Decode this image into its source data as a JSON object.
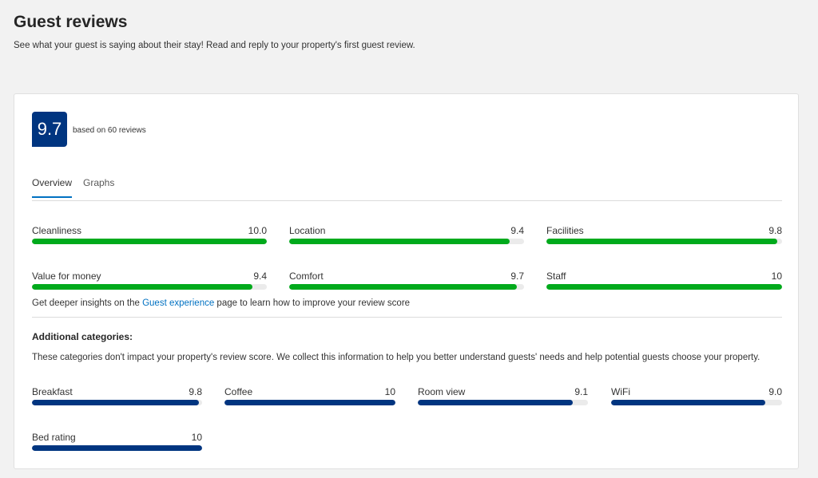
{
  "header": {
    "title": "Guest reviews",
    "subtitle": "See what your guest is saying about their stay! Read and reply to your property's first guest review."
  },
  "score": {
    "value": "9.7",
    "caption": "based on 60 reviews"
  },
  "tabs": [
    {
      "label": "Overview",
      "active": true
    },
    {
      "label": "Graphs",
      "active": false
    }
  ],
  "main_categories": [
    {
      "label": "Cleanliness",
      "value": "10.0",
      "score": 10.0
    },
    {
      "label": "Location",
      "value": "9.4",
      "score": 9.4
    },
    {
      "label": "Facilities",
      "value": "9.8",
      "score": 9.8
    },
    {
      "label": "Value for money",
      "value": "9.4",
      "score": 9.4
    },
    {
      "label": "Comfort",
      "value": "9.7",
      "score": 9.7
    },
    {
      "label": "Staff",
      "value": "10",
      "score": 10
    }
  ],
  "insight": {
    "prefix": "Get deeper insights on the ",
    "link": "Guest experience",
    "suffix": " page to learn how to improve your review score"
  },
  "additional": {
    "title": "Additional categories:",
    "description": "These categories don't impact your property's review score. We collect this information to help you better understand guests' needs and help potential guests choose your property.",
    "categories": [
      {
        "label": "Breakfast",
        "value": "9.8",
        "score": 9.8
      },
      {
        "label": "Coffee",
        "value": "10",
        "score": 10
      },
      {
        "label": "Room view",
        "value": "9.1",
        "score": 9.1
      },
      {
        "label": "WiFi",
        "value": "9.0",
        "score": 9.0
      },
      {
        "label": "Bed rating",
        "value": "10",
        "score": 10
      }
    ]
  },
  "colors": {
    "main_bar": "#00aa1c",
    "additional_bar": "#003580",
    "badge": "#003580",
    "link": "#0071c2"
  }
}
